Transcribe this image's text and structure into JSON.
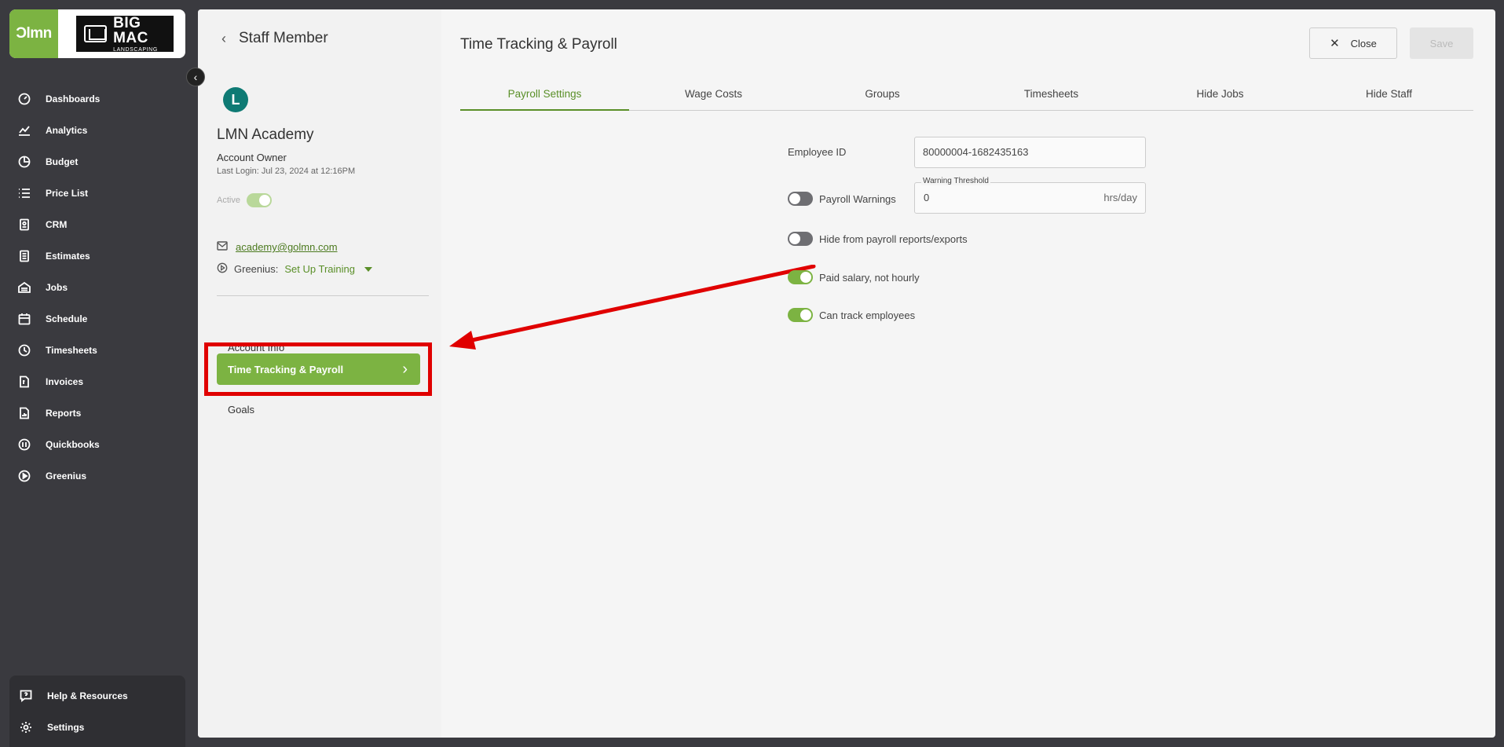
{
  "nav": {
    "logo": {
      "short": "Ɔlmn",
      "brand_line1": "BIG MAC",
      "brand_line2": "LANDSCAPING"
    },
    "items": [
      {
        "label": "Dashboards",
        "icon": "dashboard-icon"
      },
      {
        "label": "Analytics",
        "icon": "analytics-icon"
      },
      {
        "label": "Budget",
        "icon": "budget-icon"
      },
      {
        "label": "Price List",
        "icon": "list-icon"
      },
      {
        "label": "CRM",
        "icon": "crm-icon"
      },
      {
        "label": "Estimates",
        "icon": "estimates-icon"
      },
      {
        "label": "Jobs",
        "icon": "jobs-icon"
      },
      {
        "label": "Schedule",
        "icon": "calendar-icon"
      },
      {
        "label": "Timesheets",
        "icon": "clock-icon"
      },
      {
        "label": "Invoices",
        "icon": "invoice-icon"
      },
      {
        "label": "Reports",
        "icon": "reports-icon"
      },
      {
        "label": "Quickbooks",
        "icon": "quickbooks-icon"
      },
      {
        "label": "Greenius",
        "icon": "play-circle-icon"
      }
    ],
    "bottom": [
      {
        "label": "Help & Resources",
        "icon": "help-icon"
      },
      {
        "label": "Settings",
        "icon": "gear-icon"
      }
    ]
  },
  "staff": {
    "header": "Staff Member",
    "avatar_letter": "L",
    "name": "LMN Academy",
    "role": "Account Owner",
    "last_login": "Last Login: Jul 23, 2024 at 12:16PM",
    "active_label": "Active",
    "email": "academy@golmn.com",
    "greenius_label": "Greenius:",
    "greenius_value": "Set Up Training",
    "sections": {
      "account_info": "Account Info",
      "time_tracking": "Time Tracking & Payroll",
      "goals": "Goals"
    }
  },
  "content": {
    "title": "Time Tracking & Payroll",
    "close_label": "Close",
    "save_label": "Save",
    "tabs": [
      "Payroll Settings",
      "Wage Costs",
      "Groups",
      "Timesheets",
      "Hide Jobs",
      "Hide Staff"
    ],
    "employee_id_label": "Employee ID",
    "employee_id_value": "80000004-1682435163",
    "payroll_warnings_label": "Payroll Warnings",
    "warning_threshold_label": "Warning Threshold",
    "warning_threshold_value": "0",
    "warning_threshold_unit": "hrs/day",
    "hide_from_payroll_label": "Hide from payroll reports/exports",
    "paid_salary_label": "Paid salary, not hourly",
    "can_track_label": "Can track employees"
  },
  "colors": {
    "accent": "#7cb342",
    "annotation": "#e00000",
    "nav_bg": "#3a3a3f"
  }
}
